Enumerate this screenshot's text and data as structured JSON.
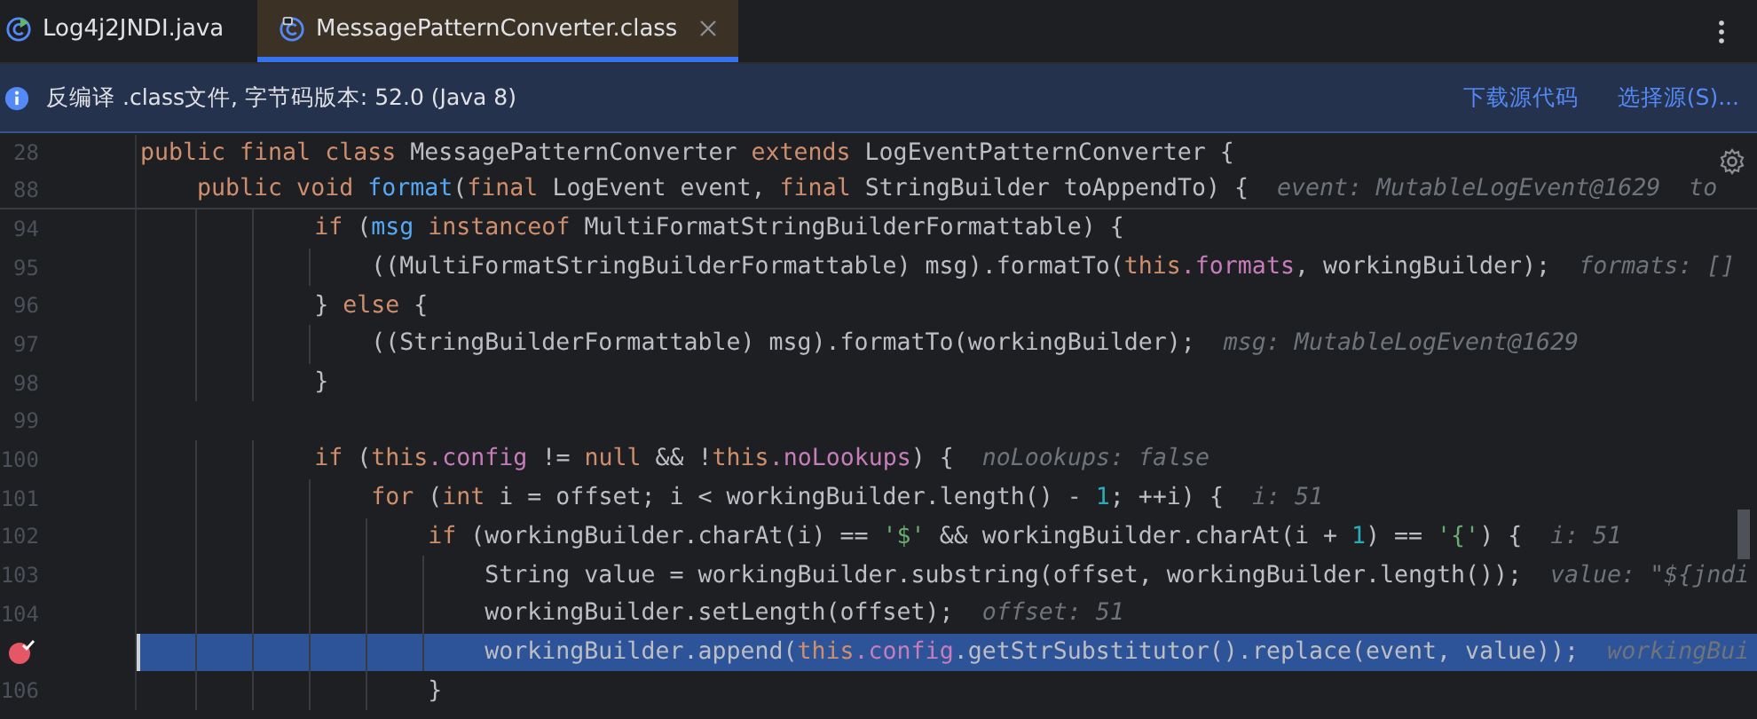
{
  "tabs": [
    {
      "label": "Log4j2JNDI.java",
      "selected": false
    },
    {
      "label": "MessagePatternConverter.class",
      "selected": true
    }
  ],
  "info_bar": {
    "message": "反编译 .class文件, 字节码版本: 52.0 (Java 8)",
    "links": [
      "下载源代码",
      "选择源(S)..."
    ]
  },
  "sticky_lines": [
    {
      "number": "28",
      "tokens": [
        {
          "kind": "keyword",
          "text": "public final class "
        },
        {
          "kind": "plain",
          "text": "MessagePatternConverter "
        },
        {
          "kind": "keyword",
          "text": "extends "
        },
        {
          "kind": "plain",
          "text": "LogEventPatternConverter {"
        }
      ]
    },
    {
      "number": "88",
      "tokens": [
        {
          "kind": "keyword",
          "text": "    public void "
        },
        {
          "kind": "method",
          "text": "format"
        },
        {
          "kind": "plain",
          "text": "("
        },
        {
          "kind": "keyword",
          "text": "final "
        },
        {
          "kind": "plain",
          "text": "LogEvent event, "
        },
        {
          "kind": "keyword",
          "text": "final "
        },
        {
          "kind": "plain",
          "text": "StringBuilder toAppendTo) {"
        }
      ],
      "hints": [
        "event: MutableLogEvent@1629",
        "to"
      ]
    }
  ],
  "lines": [
    {
      "number": "94",
      "breakpoint": false,
      "current": false,
      "tokens": [
        {
          "kind": "keyword",
          "text": "            if "
        },
        {
          "kind": "plain",
          "text": "("
        },
        {
          "kind": "method",
          "text": "msg "
        },
        {
          "kind": "keyword",
          "text": "instanceof "
        },
        {
          "kind": "plain",
          "text": "MultiFormatStringBuilderFormattable) {"
        }
      ]
    },
    {
      "number": "95",
      "breakpoint": false,
      "current": false,
      "tokens": [
        {
          "kind": "plain",
          "text": "                ((MultiFormatStringBuilderFormattable) msg).formatTo("
        },
        {
          "kind": "keyword",
          "text": "this"
        },
        {
          "kind": "field",
          "text": ".formats"
        },
        {
          "kind": "plain",
          "text": ", workingBuilder);"
        }
      ],
      "hints": [
        "formats: []"
      ]
    },
    {
      "number": "96",
      "breakpoint": false,
      "current": false,
      "tokens": [
        {
          "kind": "plain",
          "text": "            } "
        },
        {
          "kind": "keyword",
          "text": "else "
        },
        {
          "kind": "plain",
          "text": "{"
        }
      ]
    },
    {
      "number": "97",
      "breakpoint": false,
      "current": false,
      "tokens": [
        {
          "kind": "plain",
          "text": "                ((StringBuilderFormattable) msg).formatTo(workingBuilder);"
        }
      ],
      "hints": [
        "msg: MutableLogEvent@1629"
      ]
    },
    {
      "number": "98",
      "breakpoint": false,
      "current": false,
      "tokens": [
        {
          "kind": "plain",
          "text": "            }"
        }
      ]
    },
    {
      "number": "99",
      "breakpoint": false,
      "current": false
    },
    {
      "number": "100",
      "breakpoint": false,
      "current": false,
      "tokens": [
        {
          "kind": "keyword",
          "text": "            if "
        },
        {
          "kind": "plain",
          "text": "("
        },
        {
          "kind": "keyword",
          "text": "this"
        },
        {
          "kind": "field",
          "text": ".config"
        },
        {
          "kind": "plain",
          "text": " != "
        },
        {
          "kind": "keyword",
          "text": "null "
        },
        {
          "kind": "plain",
          "text": "&& !"
        },
        {
          "kind": "keyword",
          "text": "this"
        },
        {
          "kind": "field",
          "text": ".noLookups"
        },
        {
          "kind": "plain",
          "text": ") {"
        }
      ],
      "hints": [
        "noLookups: false"
      ]
    },
    {
      "number": "101",
      "breakpoint": false,
      "current": false,
      "tokens": [
        {
          "kind": "keyword",
          "text": "                for "
        },
        {
          "kind": "plain",
          "text": "("
        },
        {
          "kind": "keyword",
          "text": "int "
        },
        {
          "kind": "plain",
          "text": "i = offset; i < workingBuilder.length() - "
        },
        {
          "kind": "number",
          "text": "1"
        },
        {
          "kind": "plain",
          "text": "; ++i) {"
        }
      ],
      "hints": [
        "i: 51"
      ]
    },
    {
      "number": "102",
      "breakpoint": false,
      "current": false,
      "tokens": [
        {
          "kind": "keyword",
          "text": "                    if "
        },
        {
          "kind": "plain",
          "text": "(workingBuilder.charAt(i) == "
        },
        {
          "kind": "string",
          "text": "'$'"
        },
        {
          "kind": "plain",
          "text": " && workingBuilder.charAt(i + "
        },
        {
          "kind": "number",
          "text": "1"
        },
        {
          "kind": "plain",
          "text": ") == "
        },
        {
          "kind": "string",
          "text": "'{'"
        },
        {
          "kind": "plain",
          "text": ") {"
        }
      ],
      "hints": [
        "i: 51"
      ]
    },
    {
      "number": "103",
      "breakpoint": false,
      "current": false,
      "tokens": [
        {
          "kind": "plain",
          "text": "                        String value = workingBuilder.substring(offset, workingBuilder.length());"
        }
      ],
      "hints": [
        "value: \"${jndi"
      ]
    },
    {
      "number": "104",
      "breakpoint": false,
      "current": false,
      "tokens": [
        {
          "kind": "plain",
          "text": "                        workingBuilder.setLength(offset);"
        }
      ],
      "hints": [
        "offset: 51"
      ]
    },
    {
      "breakpoint": true,
      "current": true,
      "tokens": [
        {
          "kind": "plain",
          "text": "                        workingBuilder.append("
        },
        {
          "kind": "keyword",
          "text": "this"
        },
        {
          "kind": "field",
          "text": ".config"
        },
        {
          "kind": "plain",
          "text": ".getStrSubstitutor().replace(event, value));"
        }
      ],
      "hints": [
        "workingBui"
      ]
    },
    {
      "number": "106",
      "breakpoint": false,
      "current": false,
      "tokens": [
        {
          "kind": "plain",
          "text": "                    }"
        }
      ]
    }
  ]
}
